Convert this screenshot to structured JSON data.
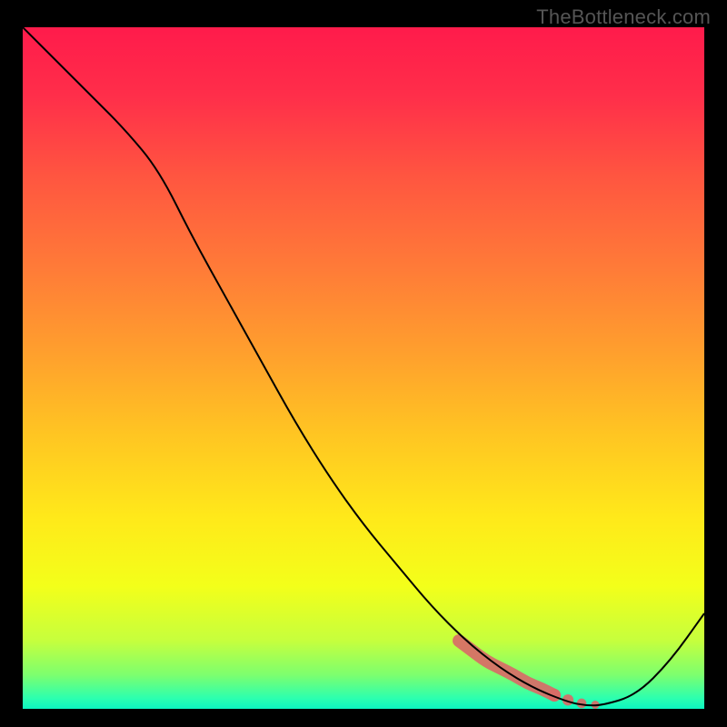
{
  "watermark": "TheBottleneck.com",
  "chart_data": {
    "type": "line",
    "title": "",
    "xlabel": "",
    "ylabel": "",
    "xlim": [
      0,
      100
    ],
    "ylim": [
      0,
      100
    ],
    "grid": false,
    "series": [
      {
        "name": "curve",
        "x": [
          0,
          5,
          10,
          15,
          20,
          25,
          30,
          35,
          40,
          45,
          50,
          55,
          60,
          65,
          70,
          75,
          80,
          82.5,
          85,
          90,
          95,
          100
        ],
        "y": [
          100,
          95,
          90,
          85,
          79,
          69,
          60,
          51,
          42,
          34,
          27,
          21,
          15,
          10,
          6,
          3,
          1,
          0.5,
          0.5,
          2,
          7,
          14
        ]
      },
      {
        "name": "highlight",
        "x": [
          64,
          66,
          68,
          70,
          72,
          74,
          76,
          78,
          80,
          82,
          84
        ],
        "y": [
          10,
          8.5,
          7,
          6,
          5,
          3.8,
          3,
          2,
          1.3,
          0.8,
          0.6
        ]
      }
    ],
    "gradient_stops": [
      {
        "offset": 0.0,
        "color": "#ff1b4b"
      },
      {
        "offset": 0.1,
        "color": "#ff2e4a"
      },
      {
        "offset": 0.22,
        "color": "#ff5640"
      },
      {
        "offset": 0.35,
        "color": "#ff7a38"
      },
      {
        "offset": 0.48,
        "color": "#ffa02d"
      },
      {
        "offset": 0.6,
        "color": "#ffc622"
      },
      {
        "offset": 0.72,
        "color": "#ffe91a"
      },
      {
        "offset": 0.82,
        "color": "#f3ff1a"
      },
      {
        "offset": 0.9,
        "color": "#c6ff3d"
      },
      {
        "offset": 0.95,
        "color": "#7dff6e"
      },
      {
        "offset": 0.985,
        "color": "#2bffb0"
      },
      {
        "offset": 1.0,
        "color": "#0cf5c0"
      }
    ],
    "series_styles": {
      "curve": {
        "stroke": "#000000",
        "width": 2
      },
      "highlight": {
        "stroke": "#d86b67",
        "width": 14,
        "linecap": "round",
        "opacity": 0.92,
        "dots_tail": true
      }
    }
  }
}
